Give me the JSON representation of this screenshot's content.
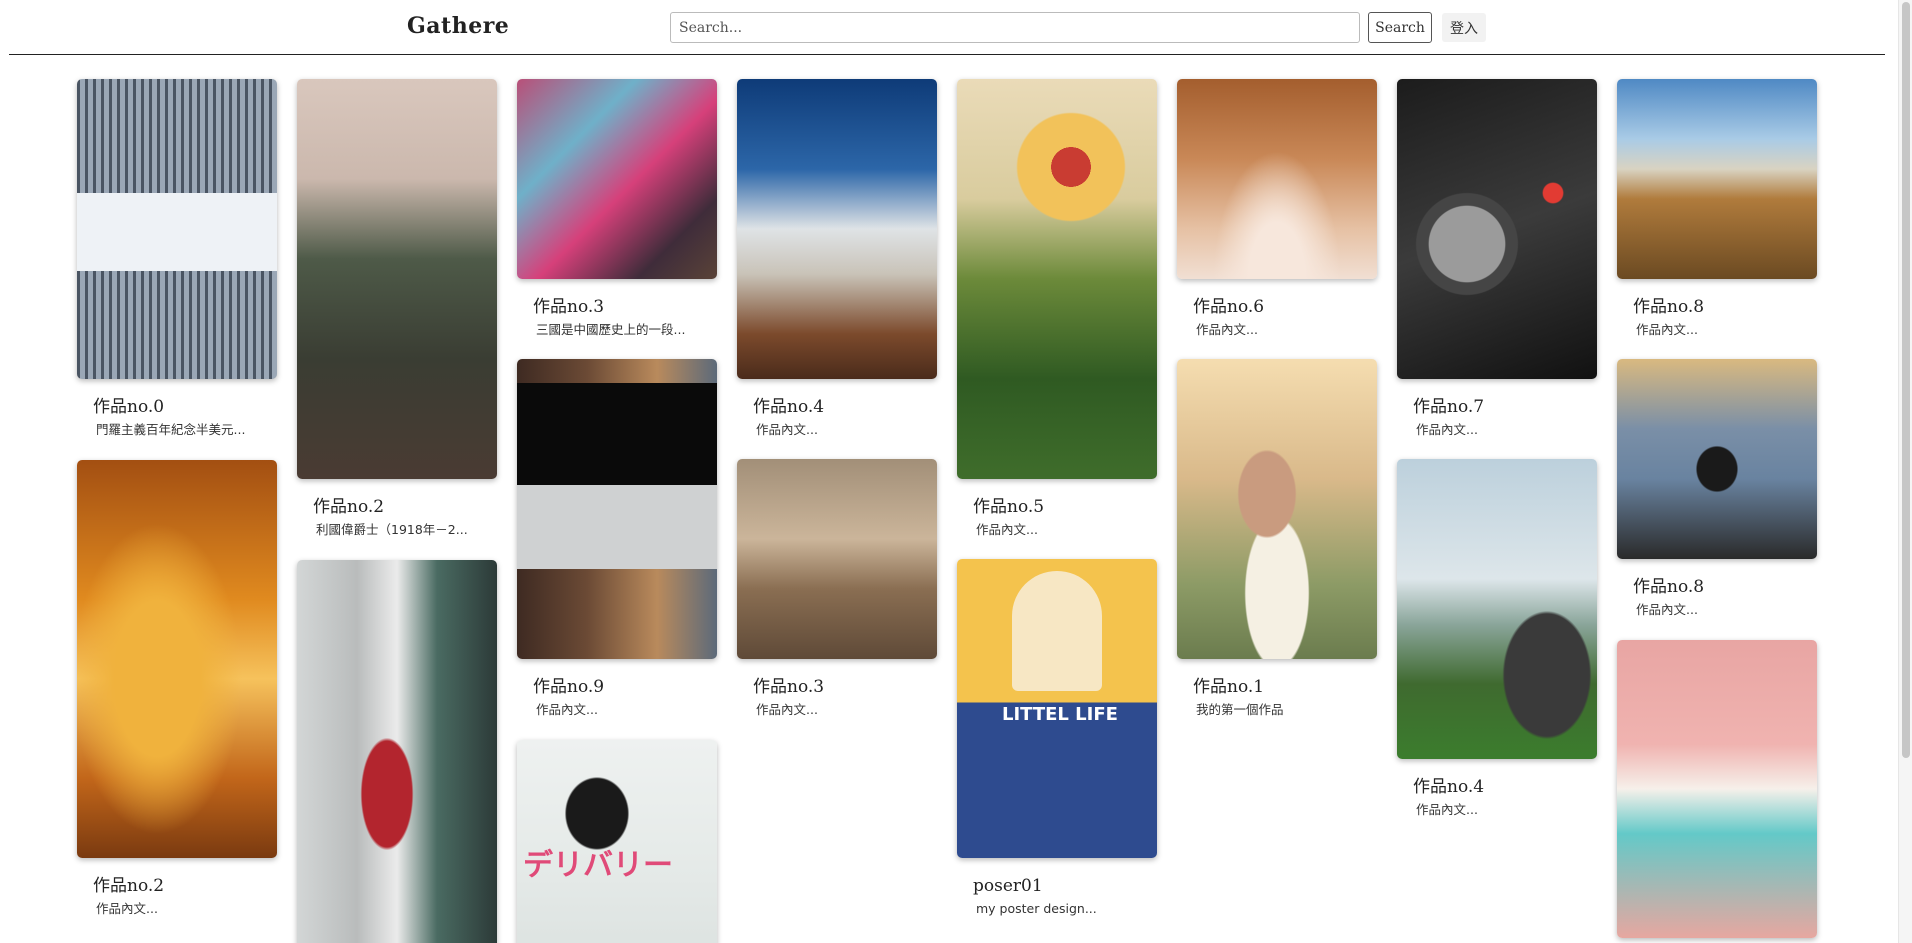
{
  "header": {
    "brand": "Gathere",
    "search_placeholder": "Search...",
    "search_label": "Search",
    "login_label": "登入"
  },
  "cards": [
    {
      "title": "作品no.0",
      "desc": "門羅主義百年紀念半美元..."
    },
    {
      "title": "作品no.2",
      "desc": "作品內文..."
    },
    {
      "title": "作品no.2",
      "desc": "利國偉爵士（1918年－2..."
    },
    {
      "title": "作品no.3",
      "desc": "三國是中國歷史上的一段..."
    },
    {
      "title": "作品no.9",
      "desc": "作品內文..."
    },
    {
      "title": "作品no.4",
      "desc": "作品內文..."
    },
    {
      "title": "作品no.3",
      "desc": "作品內文..."
    },
    {
      "title": "作品no.5",
      "desc": "作品內文..."
    },
    {
      "title": "poser01",
      "desc": "my poster design..."
    },
    {
      "title": "作品no.6",
      "desc": "作品內文..."
    },
    {
      "title": "作品no.1",
      "desc": "我的第一個作品"
    },
    {
      "title": "作品no.7",
      "desc": "作品內文..."
    },
    {
      "title": "作品no.4",
      "desc": "作品內文..."
    },
    {
      "title": "作品no.8",
      "desc": "作品內文..."
    },
    {
      "title": "作品no.8",
      "desc": "作品內文..."
    }
  ],
  "image_texts": {
    "poster_title": "LITTEL LIFE",
    "delivery_title": "デリバリー"
  }
}
